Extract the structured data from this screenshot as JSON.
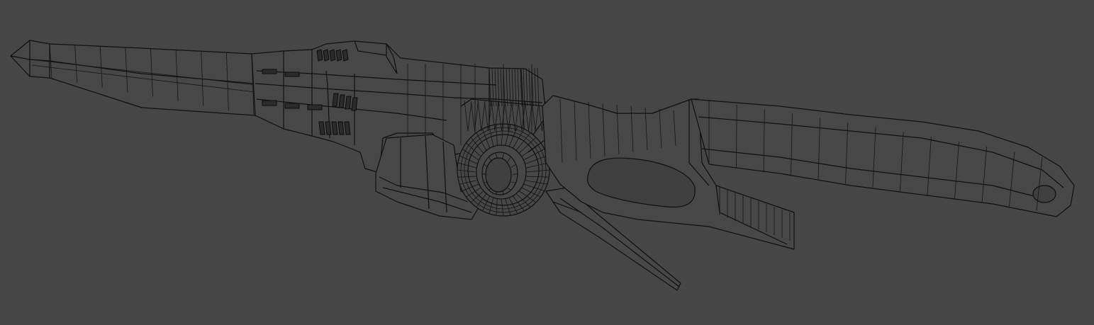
{
  "viewport": {
    "background": "#464646",
    "mesh_fill": "#474747",
    "wire_color": "#101010",
    "display_mode": "wireframe-on-shaded"
  },
  "model": {
    "icon": "wireframe-mesh-icon"
  }
}
